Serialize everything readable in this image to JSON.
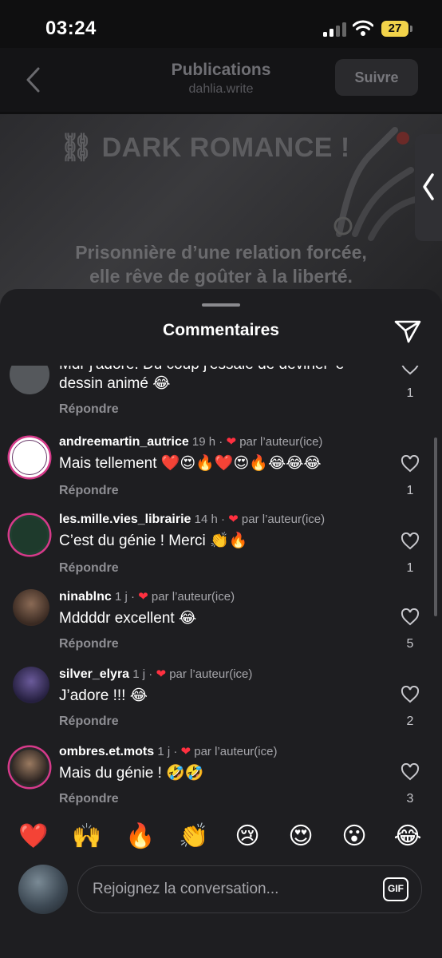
{
  "status": {
    "time": "03:24",
    "battery": "27"
  },
  "header": {
    "title": "Publications",
    "subtitle": "dahlia.write",
    "follow_label": "Suivre"
  },
  "post": {
    "title": "⛓ DARK ROMANCE !",
    "caption_line1": "Prisonnière d’une relation forcée,",
    "caption_line2": "elle rêve de goûter à la liberté."
  },
  "sheet": {
    "title": "Commentaires"
  },
  "comments": [
    {
      "username": "",
      "time": "",
      "author_badge": "",
      "text_line1": "Mdr j'adore. Du coup j'essaie de deviner 'e",
      "text_line2": "dessin animé 😂",
      "reply": "Répondre",
      "likes": "1"
    },
    {
      "username": "andreemartin_autrice",
      "time": "19 h",
      "author_badge": "par l’auteur(ice)",
      "text_line1": "Mais tellement ❤️😍🔥❤️😍🔥😂😂😂",
      "reply": "Répondre",
      "likes": "1"
    },
    {
      "username": "les.mille.vies_librairie",
      "time": "14 h",
      "author_badge": "par l’auteur(ice)",
      "text_line1": "C’est du génie ! Merci 👏🔥",
      "reply": "Répondre",
      "likes": "1"
    },
    {
      "username": "ninablnc",
      "time": "1 j",
      "author_badge": "par l’auteur(ice)",
      "text_line1": "Mddddr excellent 😂",
      "reply": "Répondre",
      "likes": "5"
    },
    {
      "username": "silver_elyra",
      "time": "1 j",
      "author_badge": "par l’auteur(ice)",
      "text_line1": "J’adore !!! 😂",
      "reply": "Répondre",
      "likes": "2"
    },
    {
      "username": "ombres.et.mots",
      "time": "1 j",
      "author_badge": "par l’auteur(ice)",
      "text_line1": "Mais du génie ! 🤣🤣",
      "reply": "Répondre",
      "likes": "3"
    }
  ],
  "emoji_bar": [
    "❤️",
    "🙌",
    "🔥",
    "👏",
    "😢",
    "😍",
    "😮",
    "😂"
  ],
  "composer": {
    "placeholder": "Rejoignez la conversation...",
    "gif_label": "GIF"
  },
  "colors": {
    "sheet_bg": "#1e1e21",
    "like_heart": "#ff3040",
    "story_ring": "#d63a8a",
    "battery": "#f2d34a"
  }
}
